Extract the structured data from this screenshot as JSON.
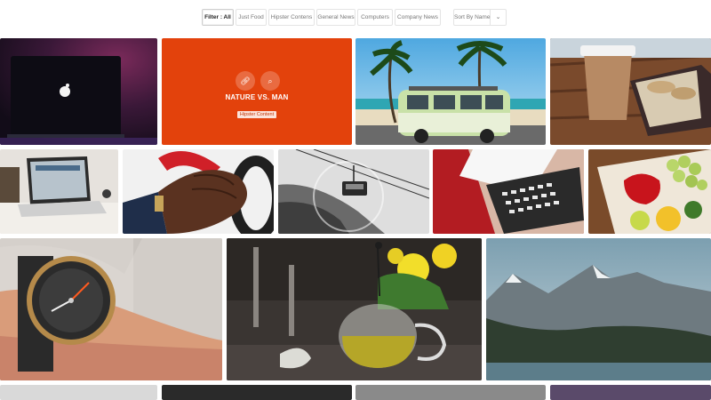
{
  "filter_bar": {
    "buttons": [
      {
        "label": "Filter : All",
        "active": true
      },
      {
        "label": "Just Food",
        "active": false
      },
      {
        "label": "Hipster Contens",
        "active": false
      },
      {
        "label": "General News",
        "active": false
      },
      {
        "label": "Computers",
        "active": false
      },
      {
        "label": "Company News",
        "active": false
      }
    ],
    "sort": {
      "label": "Sort By Name",
      "caret": "chevron-down-icon"
    }
  },
  "gallery": {
    "hover_item": {
      "title": "NATURE VS. MAN",
      "category": "Hipster Content",
      "icons": [
        "link-icon",
        "search-icon"
      ],
      "color": "#e3420c"
    },
    "items": [
      {
        "name": "macbook-dark",
        "alt": "laptop with apple logo"
      },
      {
        "name": "vw-van-beach",
        "alt": "vintage van under palm trees"
      },
      {
        "name": "coffee-cookies",
        "alt": "coffee cup and cookies"
      },
      {
        "name": "laptop-desk",
        "alt": "laptop on desk"
      },
      {
        "name": "driving-glove",
        "alt": "gloved hand on steering wheel"
      },
      {
        "name": "cable-car",
        "alt": "cable car over rocks"
      },
      {
        "name": "laptop-keyboard",
        "alt": "laptop keyboard on red"
      },
      {
        "name": "fruit-board",
        "alt": "pepper, lemon and grapes"
      },
      {
        "name": "wrist-watch",
        "alt": "watch on wrist"
      },
      {
        "name": "teapot-flowers",
        "alt": "glass teapot and flowers"
      },
      {
        "name": "mountain-lake",
        "alt": "mountain landscape"
      },
      {
        "name": "bottom-row",
        "alt": "partial bottom row"
      }
    ]
  }
}
